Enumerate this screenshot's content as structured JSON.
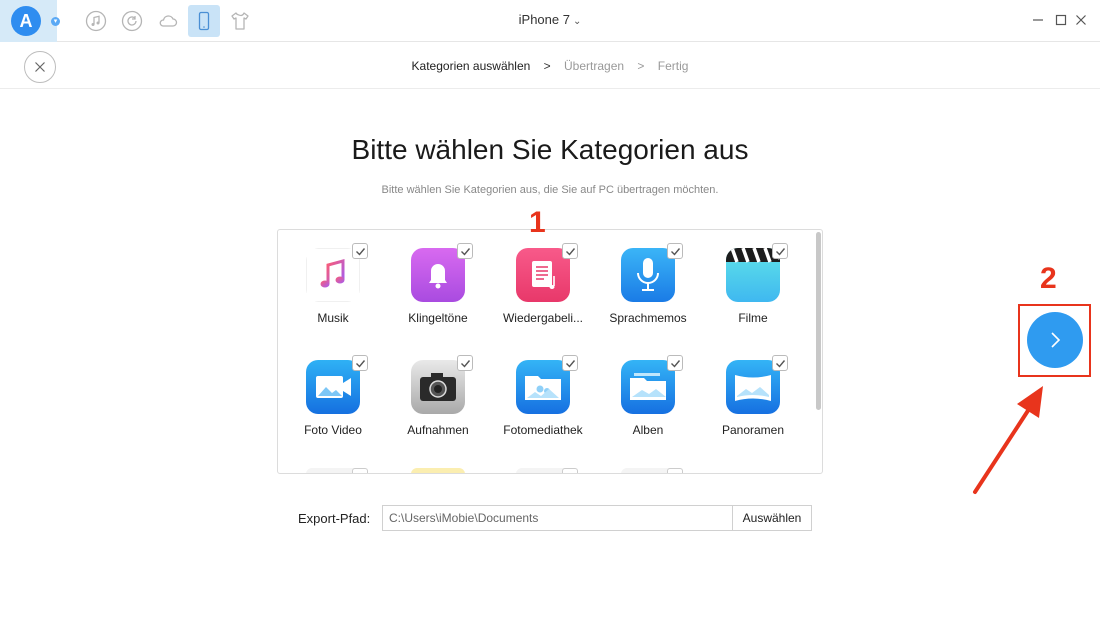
{
  "app": {
    "logo_letter": "A",
    "device_name": "iPhone 7",
    "toolbar_icons": [
      "music-note-icon",
      "restore-icon",
      "cloud-icon",
      "phone-icon",
      "tshirt-icon"
    ],
    "active_tool": "phone-icon",
    "accent_color": "#2f8df0"
  },
  "breadcrumb": {
    "steps": [
      "Kategorien auswählen",
      "Übertragen",
      "Fertig"
    ],
    "separator": ">",
    "current_index": 0
  },
  "page": {
    "title": "Bitte wählen Sie Kategorien aus",
    "subtitle": "Bitte wählen Sie Kategorien aus, die Sie auf PC übertragen möchten."
  },
  "categories": [
    {
      "label": "Musik",
      "icon": "music-icon",
      "checked": true
    },
    {
      "label": "Klingeltöne",
      "icon": "bell-icon",
      "checked": true
    },
    {
      "label": "Wiedergabeli...",
      "icon": "playlist-icon",
      "checked": true
    },
    {
      "label": "Sprachmemos",
      "icon": "microphone-icon",
      "checked": true
    },
    {
      "label": "Filme",
      "icon": "clapperboard-icon",
      "checked": true
    },
    {
      "label": "Foto Video",
      "icon": "video-camera-icon",
      "checked": true
    },
    {
      "label": "Aufnahmen",
      "icon": "camera-icon",
      "checked": true
    },
    {
      "label": "Fotomediathek",
      "icon": "photo-folder-icon",
      "checked": true
    },
    {
      "label": "Alben",
      "icon": "album-folder-icon",
      "checked": true
    },
    {
      "label": "Panoramen",
      "icon": "panorama-icon",
      "checked": true
    }
  ],
  "export": {
    "label": "Export-Pfad:",
    "path": "C:\\Users\\iMobie\\Documents",
    "button": "Auswählen"
  },
  "annotations": {
    "step_1": "1",
    "step_2": "2",
    "color": "#e8341c"
  }
}
